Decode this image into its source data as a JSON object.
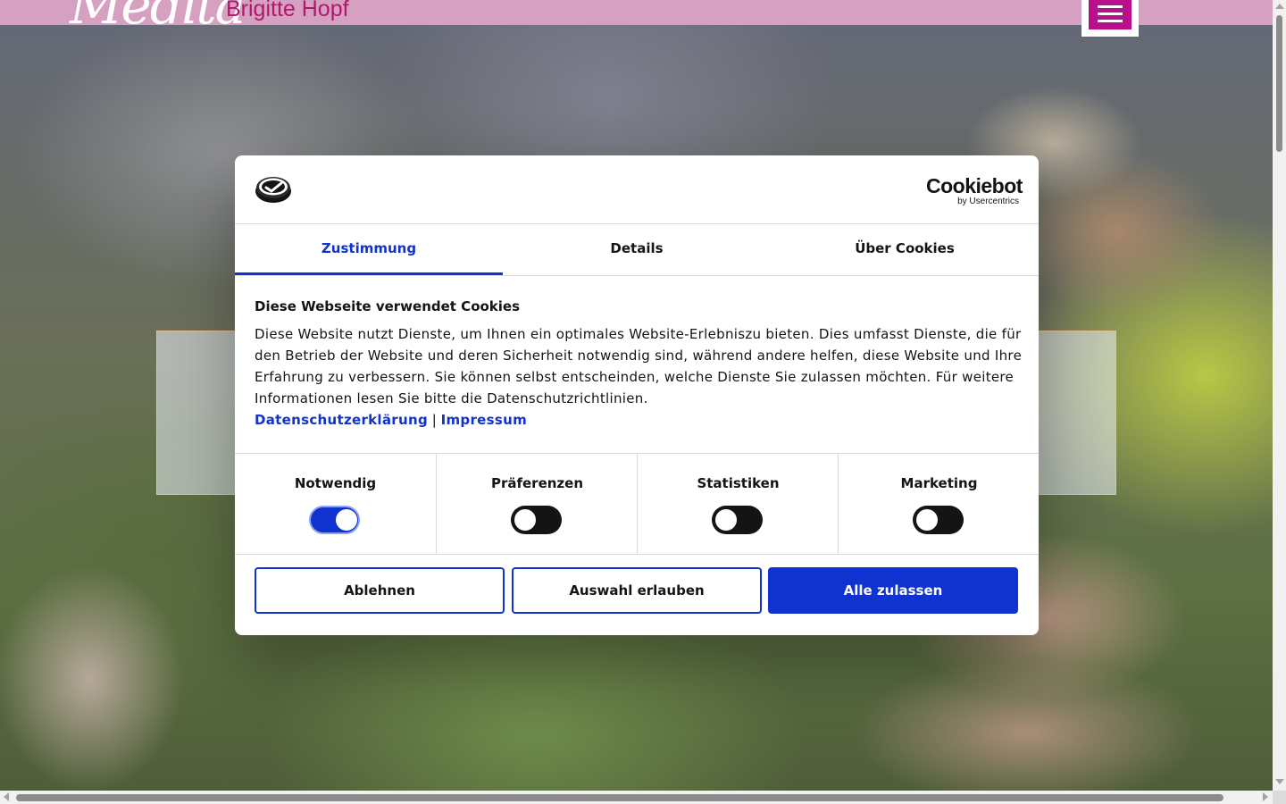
{
  "site": {
    "logo_script": "Medita",
    "logo_name": "Brigitte Hopf"
  },
  "dialog": {
    "brand_main": "Cookiebot",
    "brand_sub": "by Usercentrics",
    "tabs": [
      {
        "label": "Zustimmung",
        "active": true
      },
      {
        "label": "Details",
        "active": false
      },
      {
        "label": "Über Cookies",
        "active": false
      }
    ],
    "heading": "Diese Webseite verwendet Cookies",
    "body": "Diese Website nutzt Dienste, um Ihnen ein optimales Website-Erlebniszu bieten. Dies umfasst Dienste, die für den Betrieb der Website und deren Sicherheit notwendig sind, während andere helfen, diese Website und Ihre Erfahrung zu verbessern. Sie können selbst entscheinden, welche Dienste Sie zulassen möchten. Für weitere Informationen lesen Sie bitte die Datenschutzrichtlinien.",
    "link_privacy": "Datenschutzerklärung",
    "link_separator": "|",
    "link_imprint": "Impressum",
    "toggles": [
      {
        "label": "Notwendig",
        "on": true
      },
      {
        "label": "Präferenzen",
        "on": false
      },
      {
        "label": "Statistiken",
        "on": false
      },
      {
        "label": "Marketing",
        "on": false
      }
    ],
    "buttons": {
      "decline": "Ablehnen",
      "allow_selection": "Auswahl erlauben",
      "allow_all": "Alle zulassen"
    },
    "colors": {
      "accent": "#1032cf",
      "header_bar": "#d6a1c1",
      "menu_button": "#b90f8a",
      "brand_name": "#b4166f"
    }
  }
}
